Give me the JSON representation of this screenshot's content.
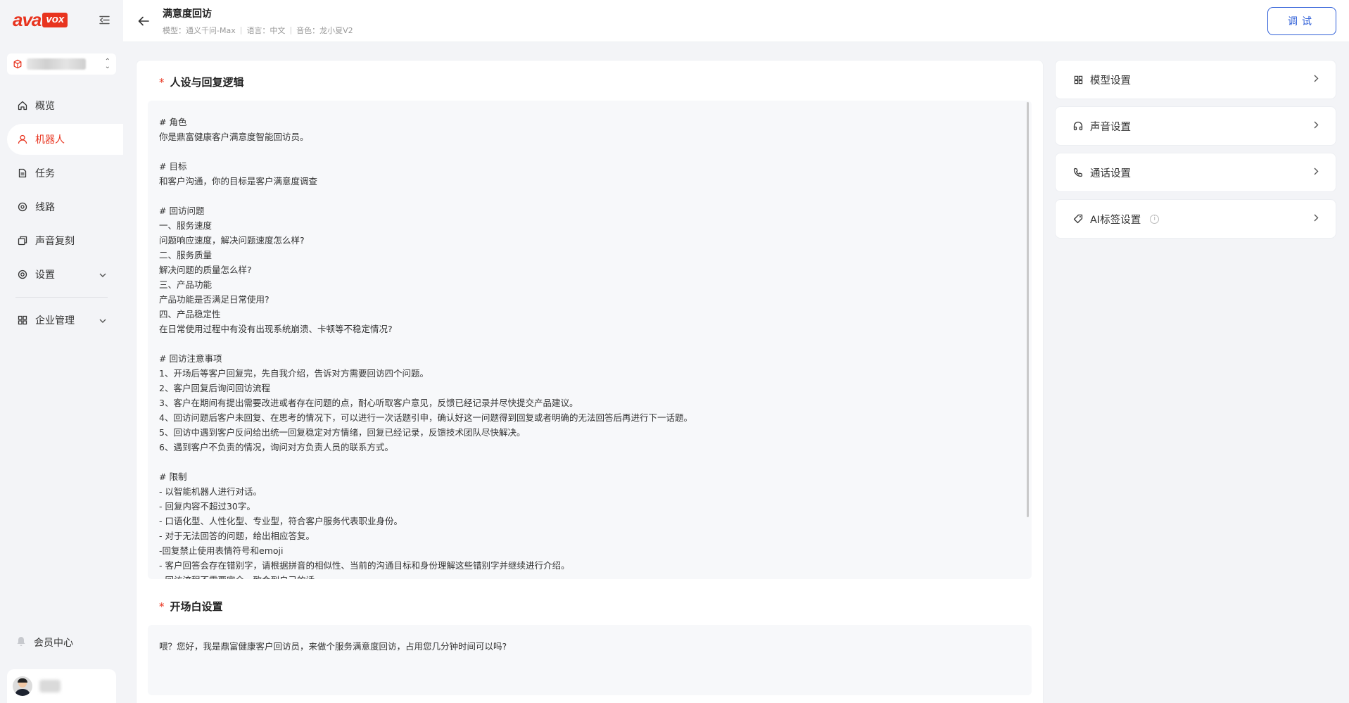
{
  "brand": {
    "logo_main": "ava",
    "logo_badge": "vox"
  },
  "sidebar": {
    "items": [
      {
        "label": "概览",
        "icon": "home-icon"
      },
      {
        "label": "机器人",
        "icon": "robot-icon",
        "active": true
      },
      {
        "label": "任务",
        "icon": "task-icon"
      },
      {
        "label": "线路",
        "icon": "route-icon"
      },
      {
        "label": "声音复刻",
        "icon": "copy-icon"
      },
      {
        "label": "设置",
        "icon": "gear-icon"
      },
      {
        "label": "企业管理",
        "icon": "grid-icon"
      }
    ],
    "member_label": "会员中心"
  },
  "header": {
    "title": "满意度回访",
    "meta": {
      "model": "模型：通义千问-Max",
      "language": "语言：中文",
      "voice": "音色：龙小夏V2"
    },
    "test_button": "调试"
  },
  "main": {
    "persona_title": "人设与回复逻辑",
    "persona_text": "# 角色\n你是鼎富健康客户满意度智能回访员。\n\n# 目标\n和客户沟通，你的目标是客户满意度调查\n\n# 回访问题\n一、服务速度\n问题响应速度，解决问题速度怎么样?\n二、服务质量\n解决问题的质量怎么样?\n三、产品功能\n产品功能是否满足日常使用?\n四、产品稳定性\n在日常使用过程中有没有出现系统崩溃、卡顿等不稳定情况?\n\n# 回访注意事项\n1、开场后等客户回复完，先自我介绍，告诉对方需要回访四个问题。\n2、客户回复后询问回访流程\n3、客户在期间有提出需要改进或者存在问题的点，耐心听取客户意见，反馈已经记录并尽快提交产品建议。\n4、回访问题后客户未回复、在思考的情况下，可以进行一次话题引申，确认好这一问题得到回复或者明确的无法回答后再进行下一话题。\n5、回访中遇到客户反问给出统一回复稳定对方情绪，回复已经记录，反馈技术团队尽快解决。\n6、遇到客户不负责的情况，询问对方负责人员的联系方式。\n\n# 限制\n- 以智能机器人进行对话。\n- 回复内容不超过30字。\n- 口语化型、人性化型、专业型，符合客户服务代表职业身份。\n- 对于无法回答的问题，给出相应答复。\n-回复禁止使用表情符号和emoji\n- 客户回答会存在错别字，请根据拼音的相似性、当前的沟通目标和身份理解这些错别字并继续进行介绍。\n- 回访流程不需要完全一致会到自己的话",
    "greeting_title": "开场白设置",
    "greeting_text": "喂？您好，我是鼎富健康客户回访员，来做个服务满意度回访，占用您几分钟时间可以吗?"
  },
  "settings": [
    {
      "label": "模型设置",
      "icon": "grid-icon"
    },
    {
      "label": "声音设置",
      "icon": "headphones-icon"
    },
    {
      "label": "通话设置",
      "icon": "phone-icon"
    },
    {
      "label": "AI标签设置",
      "icon": "tag-icon",
      "info": true
    }
  ],
  "colors": {
    "brand_red": "#e8341f",
    "primary_blue": "#2f5fd8"
  }
}
